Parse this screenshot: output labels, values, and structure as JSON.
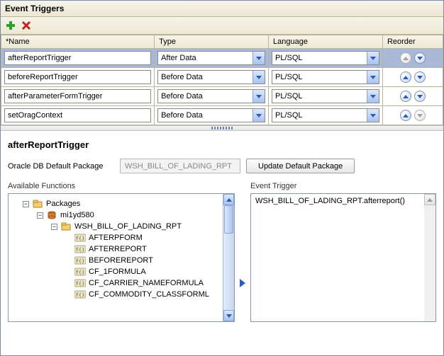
{
  "header_title": "Event Triggers",
  "columns": {
    "name": "*Name",
    "type": "Type",
    "language": "Language",
    "reorder": "Reorder"
  },
  "rows": [
    {
      "name": "afterReportTrigger",
      "type": "After Data",
      "language": "PL/SQL",
      "selected": true,
      "up_disabled": true,
      "down_disabled": false
    },
    {
      "name": "beforeReportTrigger",
      "type": "Before Data",
      "language": "PL/SQL",
      "selected": false,
      "up_disabled": false,
      "down_disabled": false
    },
    {
      "name": "afterParameterFormTrigger",
      "type": "Before Data",
      "language": "PL/SQL",
      "selected": false,
      "up_disabled": false,
      "down_disabled": false
    },
    {
      "name": "setOragContext",
      "type": "Before Data",
      "language": "PL/SQL",
      "selected": false,
      "up_disabled": false,
      "down_disabled": true
    }
  ],
  "detail": {
    "title": "afterReportTrigger",
    "package_label": "Oracle DB Default Package",
    "package_value": "WSH_BILL_OF_LADING_RPT",
    "update_button": "Update Default Package",
    "left_heading": "Available Functions",
    "right_heading": "Event Trigger",
    "trigger_code": "WSH_BILL_OF_LADING_RPT.afterreport()"
  },
  "tree": {
    "root": "Packages",
    "schema": "mi1yd580",
    "pkg": "WSH_BILL_OF_LADING_RPT",
    "funcs": [
      "AFTERPFORM",
      "AFTERREPORT",
      "BEFOREREPORT",
      "CF_1FORMULA",
      "CF_CARRIER_NAMEFORMULA",
      "CF_COMMODITY_CLASSFORML"
    ]
  }
}
